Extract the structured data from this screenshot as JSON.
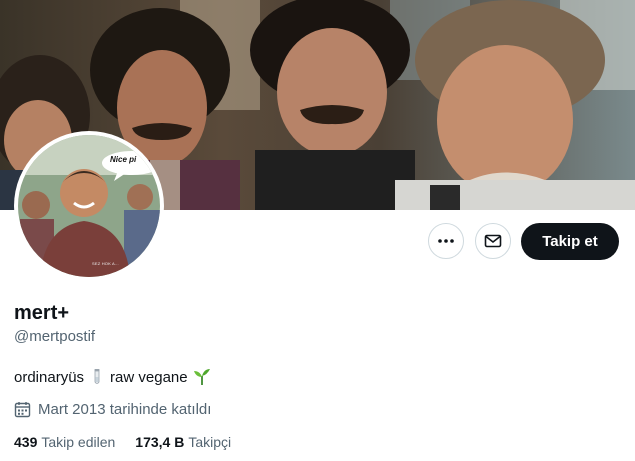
{
  "profile": {
    "display_name": "mert+",
    "handle": "@mertpostif",
    "bio": {
      "part1": "ordinaryüs",
      "emoji1": "test-tube-icon",
      "part2": "raw vegane",
      "emoji2": "seedling-icon"
    },
    "joined": "Mart 2013 tarihinde katıldı",
    "stats": {
      "following_count": "439",
      "following_label": "Takip edilen",
      "followers_count": "173,4 B",
      "followers_label": "Takipçi"
    }
  },
  "actions": {
    "more_icon": "more-icon",
    "message_icon": "mail-icon",
    "follow_label": "Takip et"
  },
  "avatar": {
    "bubble_text": "Nice pi",
    "watermark_text": "SEZ HOK A..."
  },
  "colors": {
    "text_primary": "#0f1419",
    "text_secondary": "#536471",
    "follow_button_bg": "#0f1419",
    "border": "#cfd9de"
  }
}
